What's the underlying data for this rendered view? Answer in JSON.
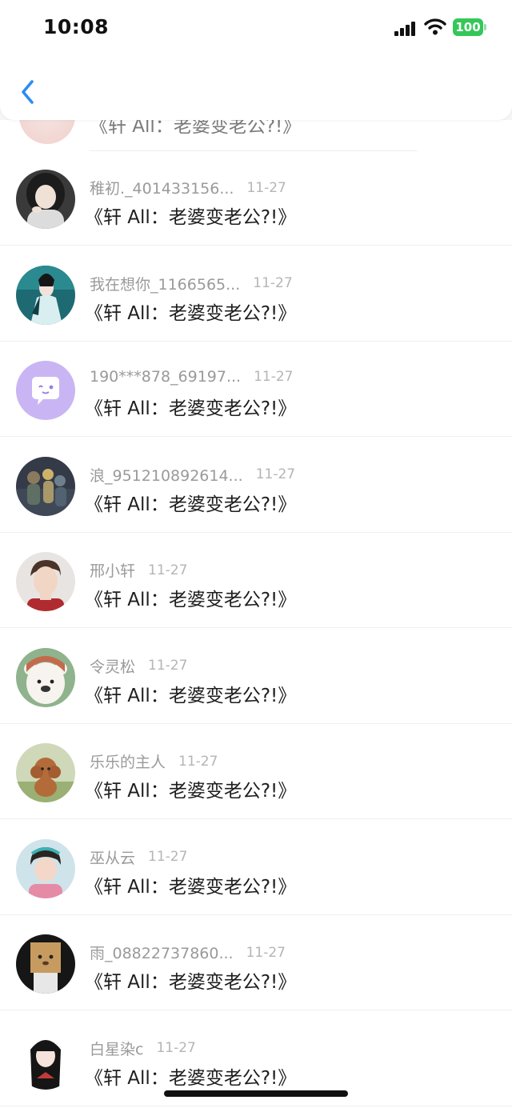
{
  "status_bar": {
    "time": "10:08",
    "battery": "100",
    "battery_color": "#34c759"
  },
  "nav": {
    "back_icon": "chevron-left-icon",
    "accent_color": "#2c8cf4"
  },
  "partial_item": {
    "message": "《轩 All：老婆变老公?!》"
  },
  "items": [
    {
      "name": "稚初._401433156...",
      "date": "11-27",
      "message": "《轩 All：老婆变老公?!》",
      "avatar": "girl-portrait-avatar"
    },
    {
      "name": "我在想你_1166565...",
      "date": "11-27",
      "message": "《轩 All：老婆变老公?!》",
      "avatar": "costume-figure-avatar"
    },
    {
      "name": "190***878_69197...",
      "date": "11-27",
      "message": "《轩 All：老婆变老公?!》",
      "avatar": "default-chat-bubble-avatar"
    },
    {
      "name": "浪_951210892614...",
      "date": "11-27",
      "message": "《轩 All：老婆变老公?!》",
      "avatar": "anime-scene-avatar"
    },
    {
      "name": "邢小轩",
      "date": "11-27",
      "message": "《轩 All：老婆变老公?!》",
      "avatar": "boy-portrait-avatar"
    },
    {
      "name": "令灵松",
      "date": "11-27",
      "message": "《轩 All：老婆变老公?!》",
      "avatar": "cartoon-bear-avatar"
    },
    {
      "name": "乐乐的主人",
      "date": "11-27",
      "message": "《轩 All：老婆变老公?!》",
      "avatar": "poodle-dog-avatar"
    },
    {
      "name": "巫从云",
      "date": "11-27",
      "message": "《轩 All：老婆变老公?!》",
      "avatar": "child-photo-avatar"
    },
    {
      "name": "雨_08822737860...",
      "date": "11-27",
      "message": "《轩 All：老婆变老公?!》",
      "avatar": "box-head-avatar"
    },
    {
      "name": "白星染c",
      "date": "11-27",
      "message": "《轩 All：老婆变老公?!》",
      "avatar": "anime-girl-avatar"
    }
  ]
}
